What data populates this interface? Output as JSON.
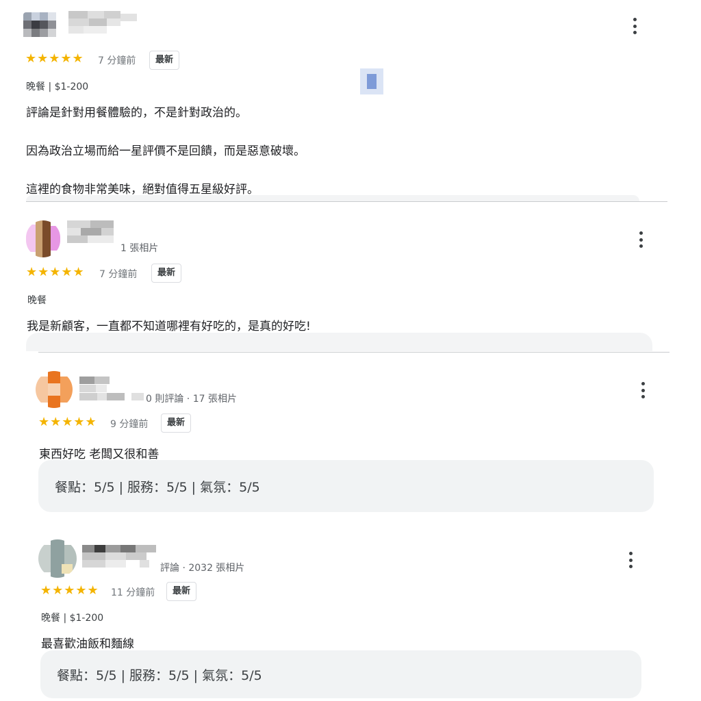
{
  "reviews": [
    {
      "meta": "",
      "stars": "★★★★★",
      "time": "7 分鐘前",
      "badge": "最新",
      "sub": "晚餐 | $1-200",
      "lines": [
        "評論是針對用餐體驗的，不是針對政治的。",
        "因為政治立場而給一星評價不是回饋，而是惡意破壞。",
        "這裡的食物非常美味，絕對值得五星級好評。"
      ]
    },
    {
      "meta": "1 張相片",
      "stars": "★★★★★",
      "time": "7 分鐘前",
      "badge": "最新",
      "sub": "晚餐",
      "lines": [
        "我是新顧客，一直都不知道哪裡有好吃的，是真的好吃!"
      ]
    },
    {
      "meta": "0 則評論 · 17 張相片",
      "stars": "★★★★★",
      "time": "9 分鐘前",
      "badge": "最新",
      "lines": [
        "東西好吃 老闆又很和善"
      ],
      "ratings": "餐點：5/5 | 服務：5/5 | 氣氛：5/5"
    },
    {
      "meta": "評論 · 2032 張相片",
      "stars": "★★★★★",
      "time": "11 分鐘前",
      "badge": "最新",
      "sub": "晚餐 | $1-200",
      "lines": [
        "最喜歡油飯和麵線"
      ],
      "ratings": "餐點：5/5 | 服務：5/5 | 氣氛：5/5"
    }
  ],
  "colors": {
    "star": "#f4b400",
    "ratings_bg": "#f1f3f4",
    "divider": "#c9cbce"
  },
  "icons": {
    "menu": "more-vert-icon",
    "star": "star-icon"
  }
}
